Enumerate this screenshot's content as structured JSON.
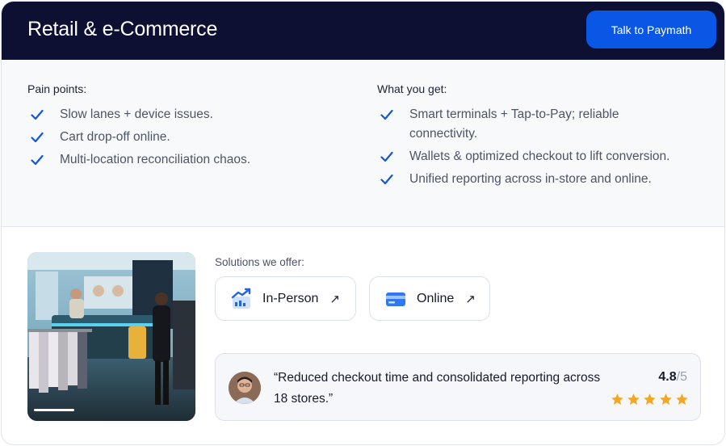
{
  "header": {
    "title": "Retail & e-Commerce",
    "cta_label": "Talk to Paymath"
  },
  "pain_points": {
    "title": "Pain points:",
    "items": [
      "Slow lanes + device issues.",
      "Cart drop-off online.",
      "Multi-location reconciliation chaos."
    ]
  },
  "benefits": {
    "title": "What you get:",
    "items": [
      "Smart terminals + Tap-to-Pay; reliable connectivity.",
      "Wallets & optimized checkout to lift conversion.",
      "Unified reporting across in-store and online."
    ]
  },
  "solutions": {
    "title": "Solutions we offer:",
    "in_person": {
      "label": "In-Person",
      "icon": "chart-terminal-icon"
    },
    "online": {
      "label": "Online",
      "icon": "card-icon"
    }
  },
  "review": {
    "quote": "“Reduced checkout time and consolidated reporting across 18 stores.”",
    "rating": "4.8",
    "rating_max": "/5",
    "stars": 5
  },
  "colors": {
    "header_bg": "#0d1033",
    "accent": "#0a57e6",
    "check": "#1557d6",
    "star": "#f5a623"
  }
}
